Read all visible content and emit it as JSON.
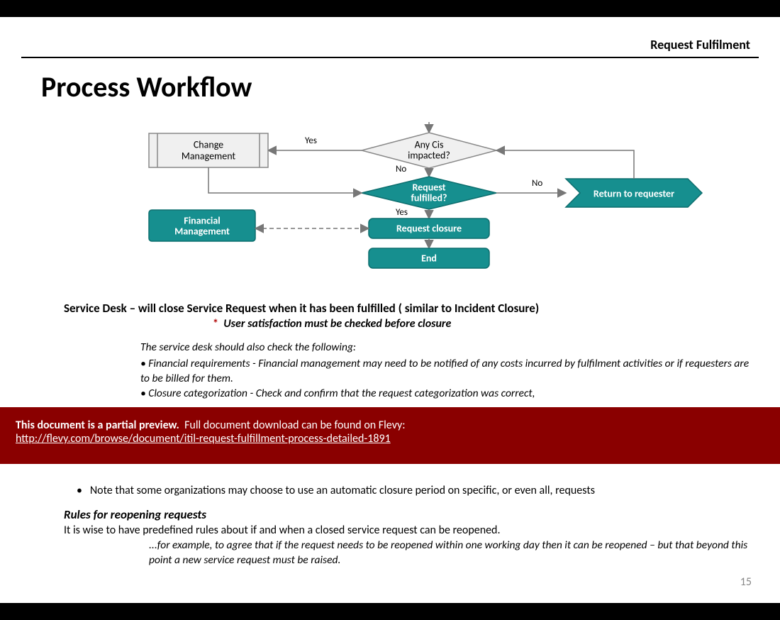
{
  "header": {
    "label": "Request Fulfilment"
  },
  "title": "Process Workflow",
  "diagram": {
    "nodes": {
      "change_mgmt": "Change\nManagement",
      "any_cis": "Any Cis\nimpacted?",
      "request_fulfilled": "Request\nfulfilled?",
      "return_requester": "Return to requester",
      "request_closure": "Request closure",
      "financial_mgmt": "Financial\nManagement",
      "end": "End"
    },
    "labels": {
      "yes1": "Yes",
      "no1": "No",
      "yes2": "Yes",
      "no2": "No"
    }
  },
  "content": {
    "service_desk_line": "Service Desk – will close Service Request when it has been fulfilled ( similar to Incident Closure)",
    "asterisk_line": "User satisfaction must be checked before closure",
    "check_intro": "The service desk should also check the following:",
    "bullets": [
      "Financial requirements - Financial management may need to be notified of any costs incurred by fulfilment activities or if requesters are to be billed for them.",
      "Closure categorization - Check and confirm that the request categorization was correct,"
    ],
    "note_after": "Note that some organizations may choose to use an automatic closure period on specific, or even all, requests",
    "rules_header": "Rules for reopening requests",
    "rules_body": "It is wise to have predefined rules about if and when a closed service request can be reopened.",
    "rules_example": "...for example, to agree that if the request needs to be reopened within one working day then it can be reopened – but that beyond this point a new service request must be raised."
  },
  "preview_banner": {
    "bold": "This document is a partial preview.",
    "rest": "Full document download can be found on Flevy:",
    "link": "http://flevy.com/browse/document/itil-request-fulfillment-process-detailed-1891"
  },
  "page_number": "15"
}
